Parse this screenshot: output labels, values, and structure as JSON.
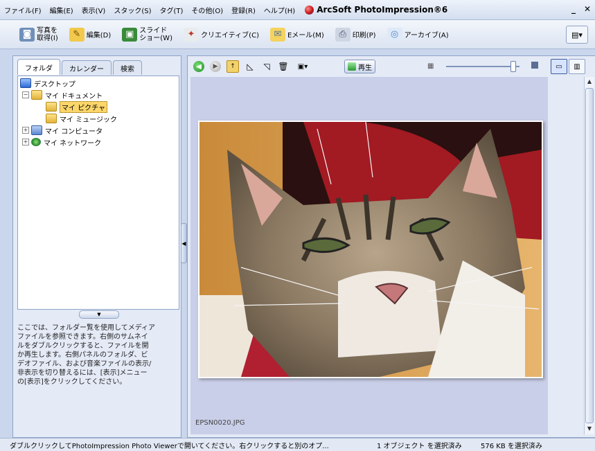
{
  "menu": [
    "ファイル(F)",
    "編集(E)",
    "表示(V)",
    "スタック(S)",
    "タグ(T)",
    "その他(O)",
    "登録(R)",
    "ヘルプ(H)"
  ],
  "app_title": "ArcSoft PhotoImpression®6",
  "window_controls": {
    "minimize": "_",
    "close": "✕"
  },
  "toolbar": [
    {
      "line1": "写真を",
      "line2": "取得(I)",
      "icon": "camera-icon",
      "color": "#6f8fb8"
    },
    {
      "line1": "編集(D)",
      "line2": "",
      "icon": "edit-icon",
      "color": "#d9a21f"
    },
    {
      "line1": "スライド",
      "line2": "ショー(W)",
      "icon": "slideshow-icon",
      "color": "#3a8a3a"
    },
    {
      "line1": "クリエイティブ(C)",
      "line2": "",
      "icon": "creative-icon",
      "color": "#c0392b"
    },
    {
      "line1": "Eメール(M)",
      "line2": "",
      "icon": "email-icon",
      "color": "#4a6fa5"
    },
    {
      "line1": "印刷(P)",
      "line2": "",
      "icon": "print-icon",
      "color": "#5a6e8f"
    },
    {
      "line1": "アーカイブ(A)",
      "line2": "",
      "icon": "archive-icon",
      "color": "#4a8ad0"
    }
  ],
  "left_panel": {
    "tabs": [
      "フォルダ",
      "カレンダー",
      "検索"
    ],
    "tree": [
      {
        "label": "デスクトップ",
        "icon": "desktop-icon"
      },
      {
        "label": "マイ ドキュメント",
        "icon": "folder-icon",
        "expander": "−"
      },
      {
        "label": "マイ ピクチャ",
        "icon": "folder-icon",
        "selected": true
      },
      {
        "label": "マイ ミュージック",
        "icon": "folder-icon"
      },
      {
        "label": "マイ コンピュータ",
        "icon": "computer-icon",
        "expander": "+"
      },
      {
        "label": "マイ ネットワーク",
        "icon": "network-icon",
        "expander": "+"
      }
    ],
    "help_lines": [
      "ここでは、フォルダー覧を使用してメディア",
      "ファイルを参照できます。右側のサムネイ",
      "ルをダブルクリックすると、ファイルを開",
      "か再生します。右側パネルのフォルダ、ビ",
      "デオファイル、および音楽ファイルの表示/",
      "非表示を切り替えるには、[表示]メニュー",
      "の[表示]をクリックしてください。"
    ]
  },
  "viewer": {
    "play_label": "再生",
    "file_name": "EPSN0020.JPG"
  },
  "status": {
    "main": "ダブルクリックしてPhotoImpression Photo Viewerで開いてください。右クリックすると別のオプ...",
    "selected_count": "1 オブジェクト を選択済み",
    "selected_size": "576 KB を選択済み"
  }
}
